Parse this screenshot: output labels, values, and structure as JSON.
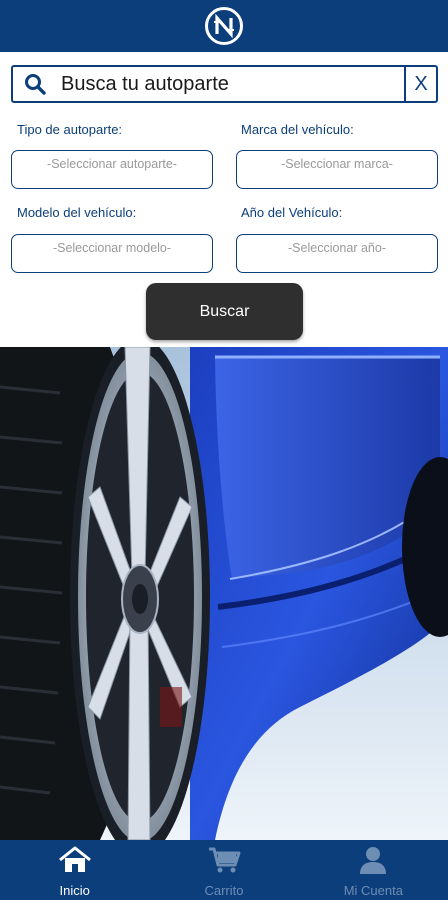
{
  "colors": {
    "primary": "#0b3e7a",
    "button_dark": "#2f2f2f",
    "placeholder": "#9a9a9a",
    "nav_inactive": "#6e8db5"
  },
  "header": {
    "logo_icon": "n-logo-icon"
  },
  "search": {
    "placeholder": "Busca tu autoparte",
    "clear_label": "X",
    "search_icon": "magnifier-icon"
  },
  "filters": {
    "part_type": {
      "label": "Tipo de autoparte:",
      "placeholder": "-Seleccionar autoparte-"
    },
    "brand": {
      "label": "Marca del vehículo:",
      "placeholder": "-Seleccionar marca-"
    },
    "model": {
      "label": "Modelo del vehículo:",
      "placeholder": "-Seleccionar modelo-"
    },
    "year": {
      "label": "Año del Vehículo:",
      "placeholder": "-Seleccionar año-"
    }
  },
  "actions": {
    "search_button": "Buscar"
  },
  "hero": {
    "image": "blue-car-wheel-photo"
  },
  "nav": {
    "items": [
      {
        "label": "Inicio",
        "icon": "home-icon",
        "active": true
      },
      {
        "label": "Carrito",
        "icon": "cart-icon",
        "active": false
      },
      {
        "label": "Mi Cuenta",
        "icon": "user-icon",
        "active": false
      }
    ]
  }
}
